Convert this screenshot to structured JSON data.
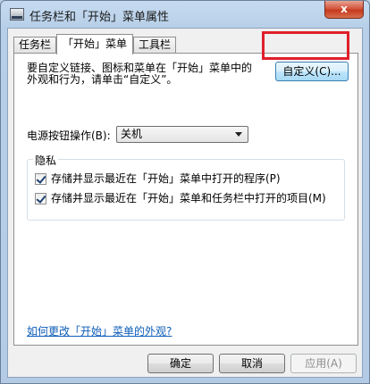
{
  "window": {
    "title": "任务栏和「开始」菜单属性",
    "close_label": "x"
  },
  "tabs": [
    {
      "label": "任务栏"
    },
    {
      "label": "「开始」菜单"
    },
    {
      "label": "工具栏"
    }
  ],
  "start_menu": {
    "description_line1": "要自定义链接、图标和菜单在「开始」菜单中的",
    "description_line2": "外观和行为，请单击“自定义”。",
    "customize_button": "自定义(C)...",
    "power_label": "电源按钮操作(B):",
    "power_value": "关机",
    "privacy_title": "隐私",
    "privacy_option1": "存储并显示最近在「开始」菜单中打开的程序(P)",
    "privacy_option2": "存储并显示最近在「开始」菜单和任务栏中打开的项目(M)",
    "help_link": "如何更改「开始」菜单的外观?"
  },
  "footer": {
    "ok": "确定",
    "cancel": "取消",
    "apply": "应用(A)"
  },
  "colors": {
    "highlight": "#e0202a",
    "link": "#0e5db8"
  }
}
